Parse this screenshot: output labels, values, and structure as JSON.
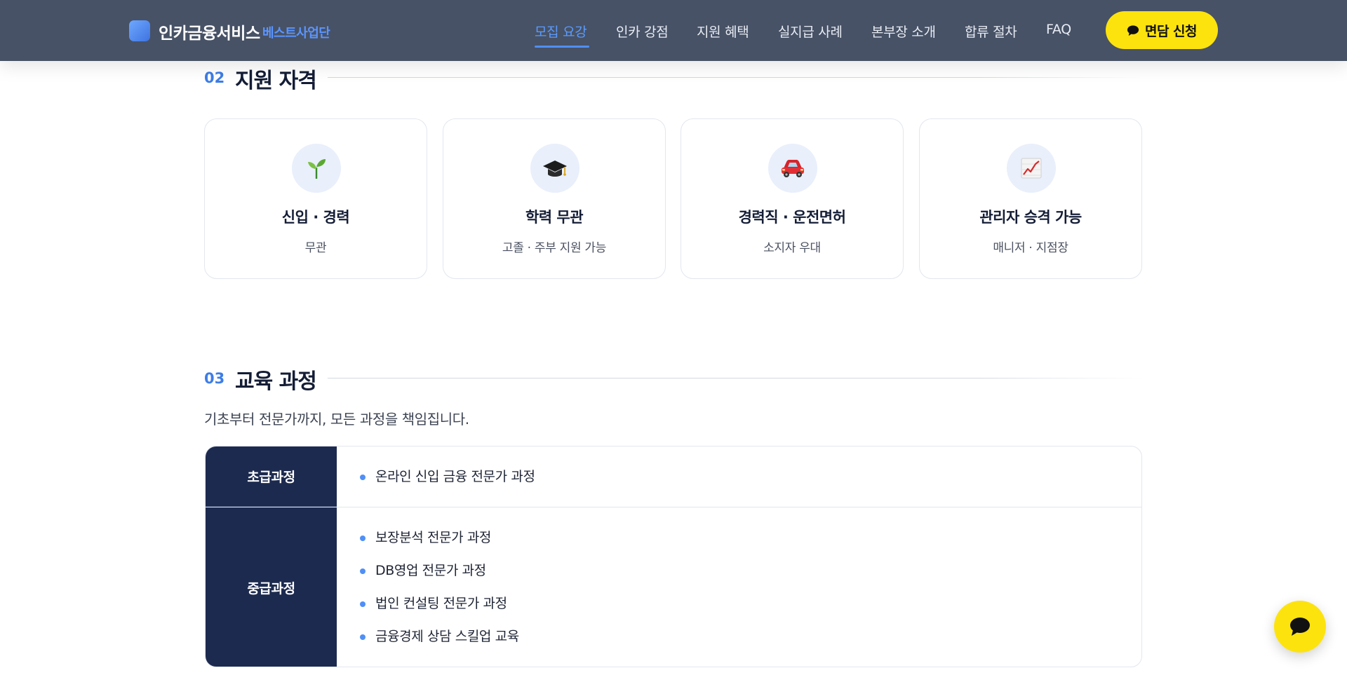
{
  "header": {
    "logo_text": "인카금융서비스",
    "logo_sub": "베스트사업단",
    "nav": [
      {
        "label": "모집 요강",
        "active": true
      },
      {
        "label": "인카 강점"
      },
      {
        "label": "지원 혜택"
      },
      {
        "label": "실지급 사례"
      },
      {
        "label": "본부장 소개"
      },
      {
        "label": "합류 절차"
      },
      {
        "label": "FAQ"
      }
    ],
    "cta_label": "면담 신청"
  },
  "qualifications": {
    "number": "02",
    "title": "지원 자격",
    "cards": [
      {
        "icon": "sprout-icon",
        "emoji": "🌱",
        "title": "신입 · 경력",
        "desc": "무관"
      },
      {
        "icon": "graduation-cap-icon",
        "emoji": "🎓",
        "title": "학력 무관",
        "desc": "고졸 · 주부 지원 가능"
      },
      {
        "icon": "car-icon",
        "emoji": "🚗",
        "title": "경력직 · 운전면허",
        "desc": "소지자 우대"
      },
      {
        "icon": "chart-increasing-icon",
        "emoji": "📈",
        "title": "관리자 승격 가능",
        "desc": "매니저 · 지점장"
      }
    ]
  },
  "education": {
    "number": "03",
    "title": "교육 과정",
    "intro": "기초부터 전문가까지, 모든 과정을 책임집니다.",
    "courses": [
      {
        "level": "초급과정",
        "items": [
          "온라인 신입 금융 전문가 과정"
        ]
      },
      {
        "level": "중급과정",
        "items": [
          "보장분석 전문가 과정",
          "DB영업 전문가 과정",
          "법인 컨설팅 전문가 과정",
          "금융경제 상담 스킬업 교육"
        ]
      }
    ]
  },
  "colors": {
    "header_bg": "#475266",
    "accent_blue": "#4f8ff7",
    "cta_yellow": "#fde30d",
    "navy": "#1d2a4f"
  }
}
